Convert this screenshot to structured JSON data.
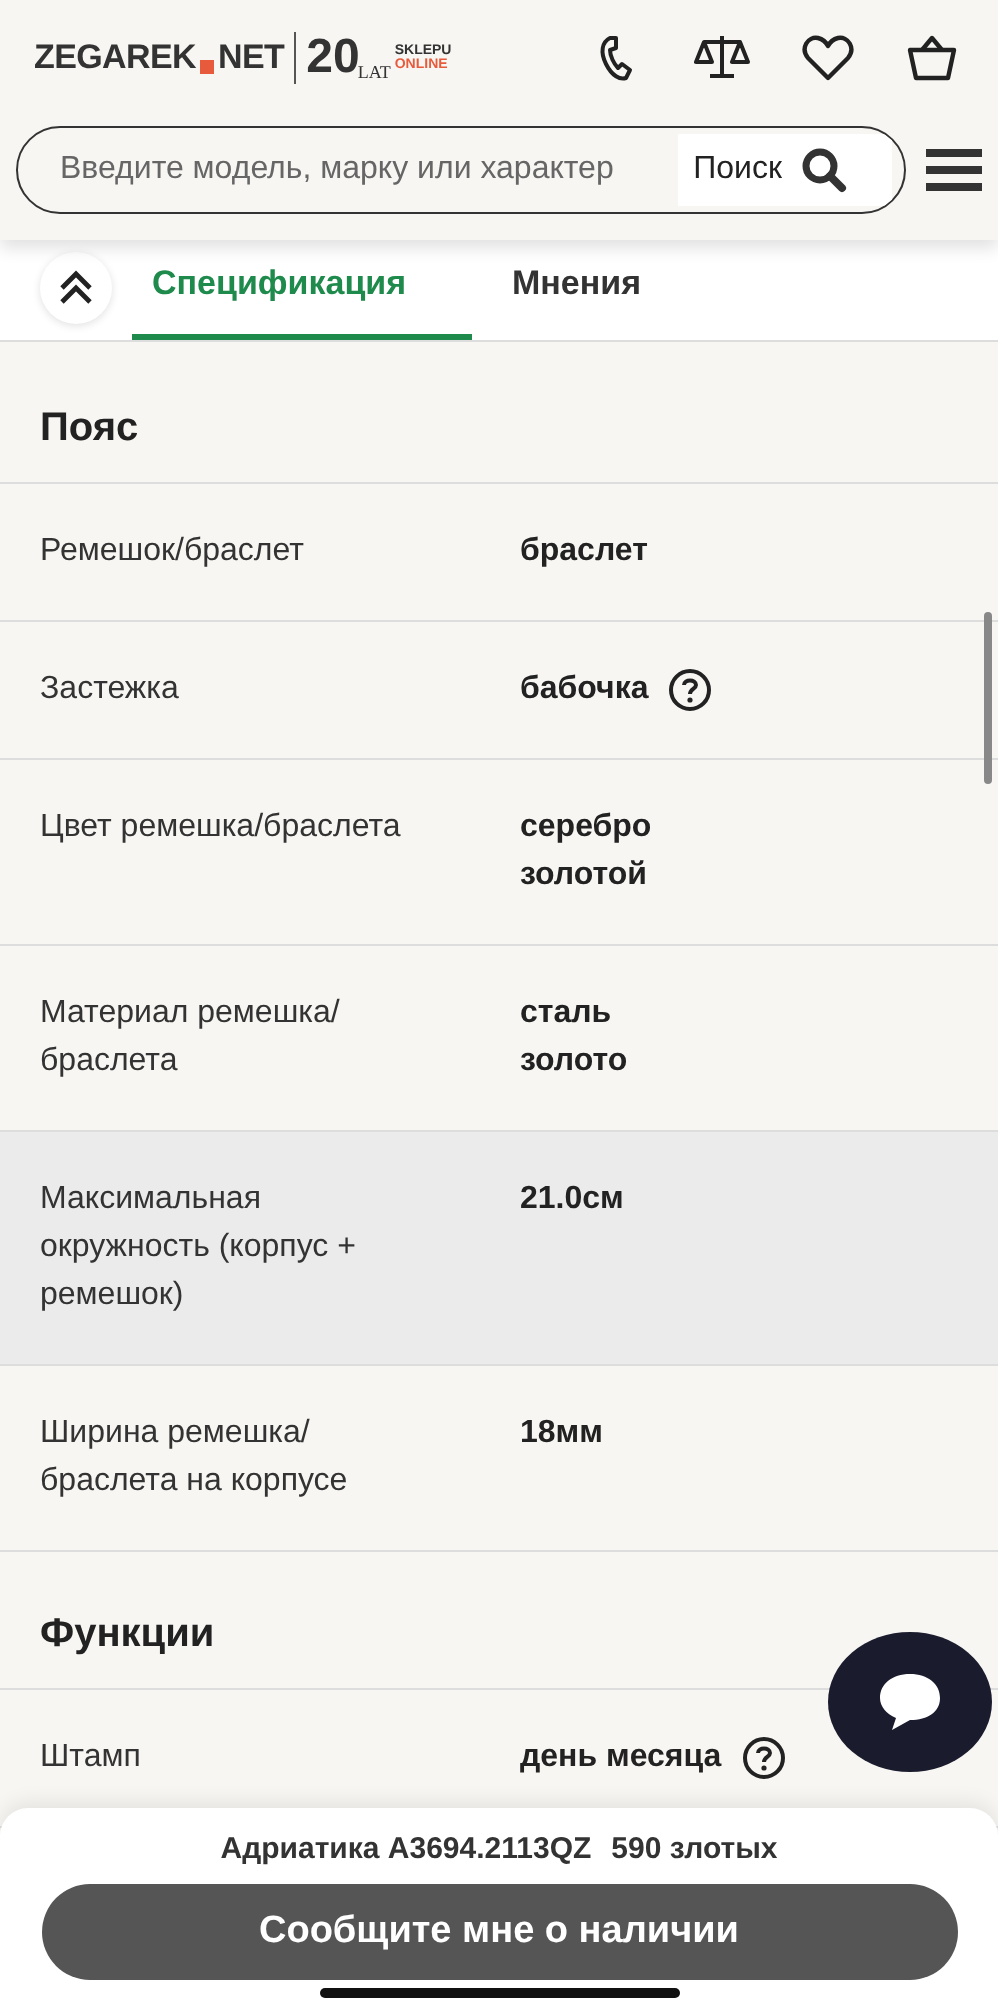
{
  "header": {
    "logo": {
      "brand_left": "ZEGAREK",
      "brand_right": "NET",
      "years": "20",
      "lat": "LAT",
      "sklepu": "SKLEPU",
      "online": "ONLINE"
    }
  },
  "search": {
    "placeholder": "Введите модель, марку или характер",
    "button": "Поиск"
  },
  "tabs": [
    {
      "label": "Спецификация",
      "selected": true
    },
    {
      "label": "Мнения",
      "selected": false
    }
  ],
  "sections": [
    {
      "title": "Пояс",
      "rows": [
        {
          "label": "Ремешок/браслет",
          "values": [
            "браслет"
          ],
          "help": false,
          "highlighted": false
        },
        {
          "label": "Застежка",
          "values": [
            "бабочка"
          ],
          "help": true,
          "highlighted": false
        },
        {
          "label": "Цвет ремешка/браслета",
          "values": [
            "серебро",
            "золотой"
          ],
          "help": false,
          "highlighted": false
        },
        {
          "label": "Материал ремешка/ браслета",
          "values": [
            "сталь",
            "золото"
          ],
          "help": false,
          "highlighted": false
        },
        {
          "label": "Максимальная окружность (корпус + ремешок)",
          "values": [
            "21.0см"
          ],
          "help": false,
          "highlighted": true
        },
        {
          "label": "Ширина ремешка/ браслета на корпусе",
          "values": [
            "18мм"
          ],
          "help": false,
          "highlighted": false
        }
      ]
    },
    {
      "title": "Функции",
      "rows": [
        {
          "label": "Штамп",
          "values": [
            "день месяца"
          ],
          "help": true,
          "highlighted": false
        }
      ]
    }
  ],
  "bottom_bar": {
    "product": "Адриатика A3694.2113QZ",
    "price": "590 злотых",
    "button": "Сообщите мне о наличии"
  }
}
